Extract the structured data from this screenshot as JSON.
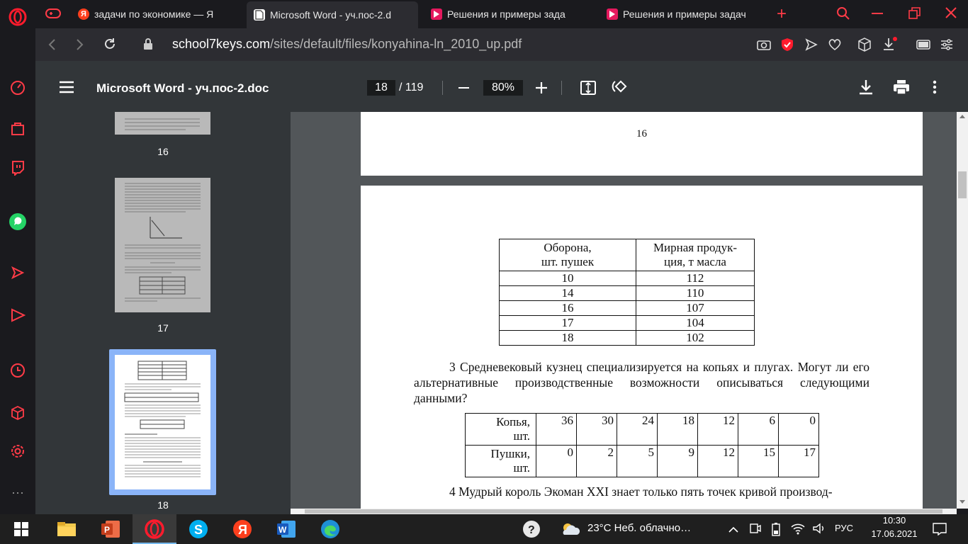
{
  "tabs": [
    {
      "label": "задачи по экономике — Я",
      "favicon": "Я",
      "active": false
    },
    {
      "label": "Microsoft Word - уч.пос-2.d",
      "favicon": "doc",
      "active": true
    },
    {
      "label": "Решения и примеры зада",
      "favicon": "arrow",
      "active": false
    },
    {
      "label": "Решения и примеры задач",
      "favicon": "arrow",
      "active": false
    }
  ],
  "address": {
    "host": "school7keys.com",
    "path": "/sites/default/files/konyahina-ln_2010_up.pdf"
  },
  "pdf_toolbar": {
    "title": "Microsoft Word - уч.пос-2.doc",
    "current_page": "18",
    "total_pages": "/ 119",
    "zoom": "80%"
  },
  "thumbnails": [
    {
      "label": "16"
    },
    {
      "label": "17"
    },
    {
      "label": "18",
      "selected": true
    }
  ],
  "page16": {
    "number": "16"
  },
  "table1": {
    "headers": [
      "Оборона,\nшт. пушек",
      "Мирная продук-\nция, т масла"
    ],
    "rows": [
      [
        "10",
        "112"
      ],
      [
        "14",
        "110"
      ],
      [
        "16",
        "107"
      ],
      [
        "17",
        "104"
      ],
      [
        "18",
        "102"
      ]
    ]
  },
  "task3": "3 Средневековый кузнец специализируется на копьях и плугах. Могут ли его альтернативные производственные возможности описываться следующими данными?",
  "table2": {
    "row1_label": "Копья,\nшт.",
    "row1": [
      "36",
      "30",
      "24",
      "18",
      "12",
      "6",
      "0"
    ],
    "row2_label": "Пушки,\nшт.",
    "row2": [
      "0",
      "2",
      "5",
      "9",
      "12",
      "15",
      "17"
    ]
  },
  "task4": "4 Мудрый король Экоман XXI знает только пять точек кривой производ-",
  "taskbar": {
    "weather": "23°C  Неб. облачно…",
    "lang": "РУС",
    "time": "10:30",
    "date": "17.06.2021"
  },
  "colors": {
    "opera_red": "#ff1b2d",
    "accent_blue": "#8ab4f8"
  }
}
